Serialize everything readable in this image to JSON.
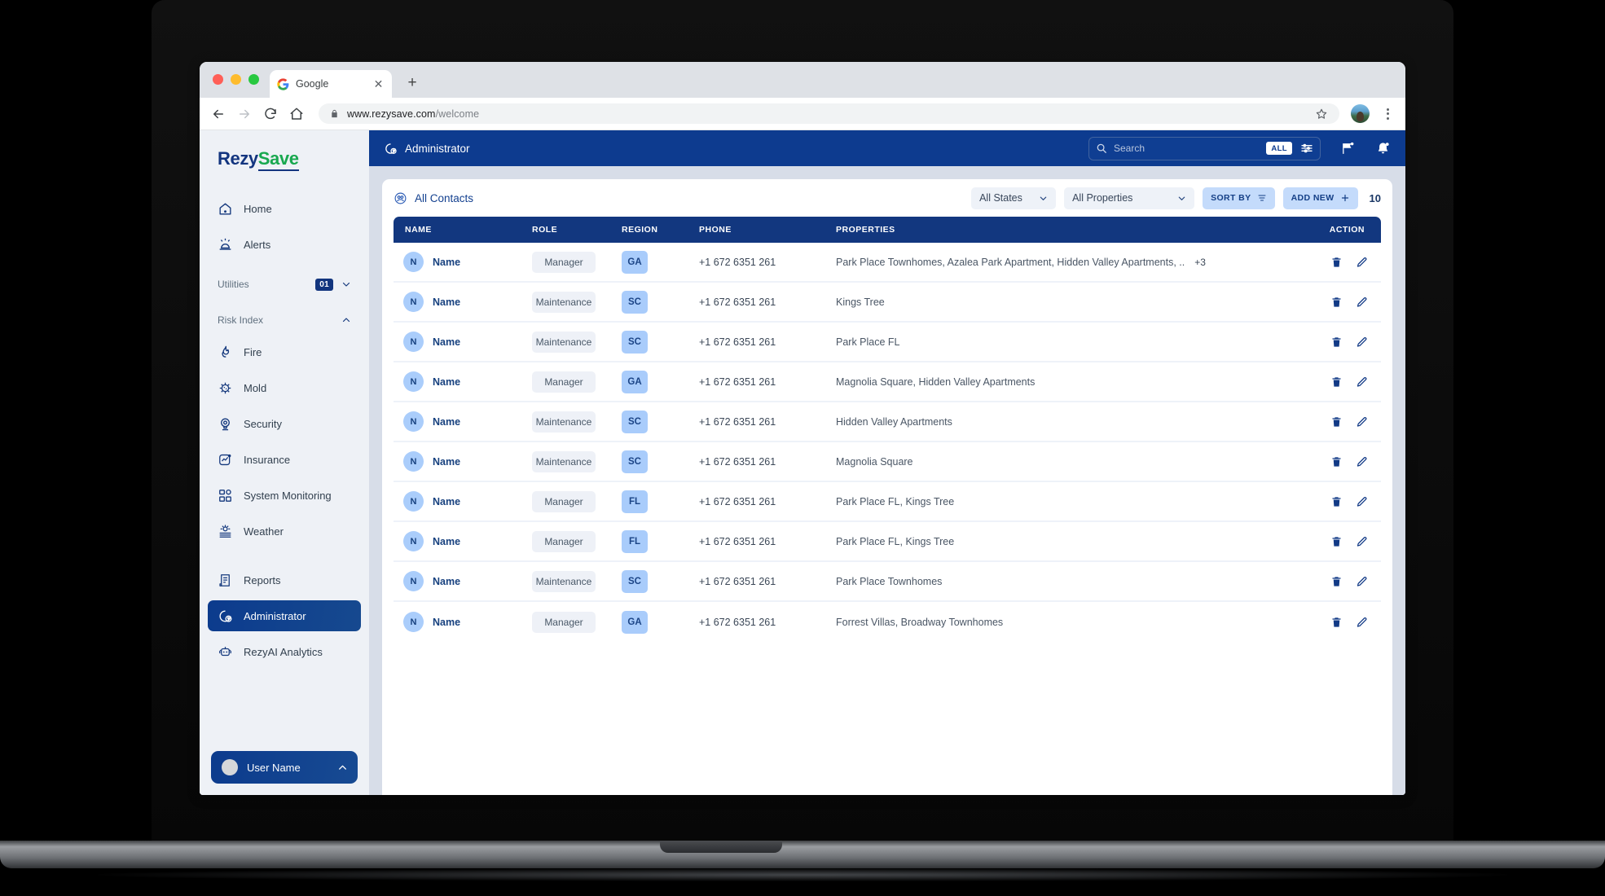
{
  "browser": {
    "tab_title": "Google",
    "tab_favicon": "google-icon",
    "url_domain": "www.rezysave.com",
    "url_path": "/welcome",
    "new_tab_label": "+",
    "close_label": "✕"
  },
  "sidebar": {
    "logo": {
      "part1": "Rezy",
      "part2": "Save"
    },
    "items": [
      {
        "label": "Home",
        "icon": "home-icon"
      },
      {
        "label": "Alerts",
        "icon": "alarm-icon"
      }
    ],
    "utilities": {
      "label": "Utilities",
      "badge": "01",
      "icon": "chevron-down-icon"
    },
    "risk_index": {
      "label": "Risk Index",
      "icon": "chevron-up-icon"
    },
    "risk_items": [
      {
        "label": "Fire",
        "icon": "flame-icon"
      },
      {
        "label": "Mold",
        "icon": "germ-icon"
      },
      {
        "label": "Security",
        "icon": "camera-icon"
      },
      {
        "label": "Insurance",
        "icon": "chart-shield-icon"
      },
      {
        "label": "System Monitoring",
        "icon": "grid-icon"
      },
      {
        "label": "Weather",
        "icon": "weather-icon"
      }
    ],
    "lower_items": [
      {
        "label": "Reports",
        "icon": "report-icon",
        "active": false
      },
      {
        "label": "Administrator",
        "icon": "admin-icon",
        "active": true
      },
      {
        "label": "RezyAI Analytics",
        "icon": "robot-icon",
        "active": false
      }
    ],
    "user": {
      "label": "User Name",
      "icon": "chevron-up-icon",
      "avatar": "avatar"
    }
  },
  "topbar": {
    "title": "Administrator",
    "title_icon": "admin-icon",
    "search": {
      "placeholder": "Search",
      "icon": "search-icon",
      "pill": "ALL",
      "filter_icon": "sliders-icon"
    },
    "flag_icon": "flag-icon",
    "bell_icon": "bell-icon"
  },
  "toolbar": {
    "title": "All Contacts",
    "title_icon": "contacts-icon",
    "state_filter": "All States",
    "property_filter": "All Properties",
    "sort_label": "SORT BY",
    "sort_icon": "sort-icon",
    "add_label": "ADD NEW",
    "add_icon": "plus-icon",
    "count": "10"
  },
  "table": {
    "columns": [
      "NAME",
      "ROLE",
      "REGION",
      "PHONE",
      "PROPERTIES",
      "ACTION"
    ],
    "rows": [
      {
        "avatar": "N",
        "name": "Name",
        "role": "Manager",
        "region": "GA",
        "phone": "+1 672 6351 261",
        "properties": "Park Place Townhomes, Azalea Park Apartment, Hidden Valley Apartments, ..",
        "more": "+3"
      },
      {
        "avatar": "N",
        "name": "Name",
        "role": "Maintenance",
        "region": "SC",
        "phone": "+1 672 6351 261",
        "properties": "Kings Tree",
        "more": ""
      },
      {
        "avatar": "N",
        "name": "Name",
        "role": "Maintenance",
        "region": "SC",
        "phone": "+1 672 6351 261",
        "properties": "Park Place FL",
        "more": ""
      },
      {
        "avatar": "N",
        "name": "Name",
        "role": "Manager",
        "region": "GA",
        "phone": "+1 672 6351 261",
        "properties": "Magnolia Square, Hidden Valley Apartments",
        "more": ""
      },
      {
        "avatar": "N",
        "name": "Name",
        "role": "Maintenance",
        "region": "SC",
        "phone": "+1 672 6351 261",
        "properties": "Hidden Valley Apartments",
        "more": ""
      },
      {
        "avatar": "N",
        "name": "Name",
        "role": "Maintenance",
        "region": "SC",
        "phone": "+1 672 6351 261",
        "properties": "Magnolia Square",
        "more": ""
      },
      {
        "avatar": "N",
        "name": "Name",
        "role": "Manager",
        "region": "FL",
        "phone": "+1 672 6351 261",
        "properties": "Park Place FL, Kings Tree",
        "more": ""
      },
      {
        "avatar": "N",
        "name": "Name",
        "role": "Manager",
        "region": "FL",
        "phone": "+1 672 6351 261",
        "properties": "Park Place FL, Kings Tree",
        "more": ""
      },
      {
        "avatar": "N",
        "name": "Name",
        "role": "Maintenance",
        "region": "SC",
        "phone": "+1 672 6351 261",
        "properties": "Park Place Townhomes",
        "more": ""
      },
      {
        "avatar": "N",
        "name": "Name",
        "role": "Manager",
        "region": "GA",
        "phone": "+1 672 6351 261",
        "properties": "Forrest Villas, Broadway Townhomes",
        "more": ""
      }
    ],
    "row_actions": {
      "delete_icon": "trash-icon",
      "edit_icon": "pencil-icon"
    }
  },
  "colors": {
    "brand_navy": "#12377f",
    "brand_green": "#18a84f",
    "topbar_blue": "#0d3b8f",
    "page_bg": "#d7dde8",
    "sidebar_bg": "#eef1f6",
    "chip_blue": "#c4dbfb",
    "region_blue": "#a9ccfb"
  }
}
